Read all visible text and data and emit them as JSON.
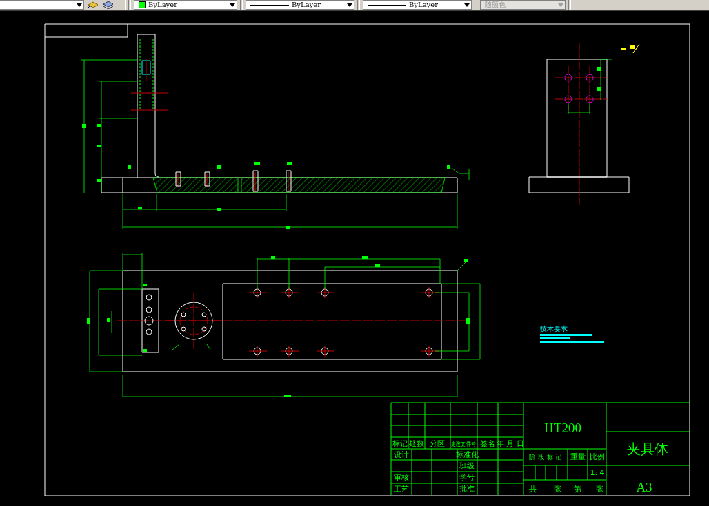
{
  "toolbar": {
    "items": [
      {
        "kind": "cut"
      },
      {
        "kind": "layer-icons"
      },
      {
        "kind": "color",
        "value": "ByLayer",
        "disabled": false
      },
      {
        "kind": "linetype",
        "value": "ByLayer",
        "disabled": false
      },
      {
        "kind": "lineweight",
        "value": "ByLayer",
        "disabled": false
      },
      {
        "kind": "plotstyle",
        "value": "随颜色",
        "disabled": true
      }
    ]
  },
  "notes": {
    "heading": "技术要求"
  },
  "title_block": {
    "header_labels": [
      "标记",
      "处数",
      "分区",
      "更改文件号",
      "签名",
      "年 月 日"
    ],
    "left_labels": [
      "设计",
      "审核",
      "工艺"
    ],
    "mid_labels": [
      "标准化",
      "班级",
      "学号",
      "批准"
    ],
    "stage_labels": [
      "阶 段 标 记",
      "重量",
      "比例"
    ],
    "scale": "1: 4",
    "sheet_count_labels": [
      "共",
      "张",
      "第",
      "张"
    ],
    "material": "HT200",
    "part_name": "夹具体",
    "sheet_size": "A3"
  }
}
